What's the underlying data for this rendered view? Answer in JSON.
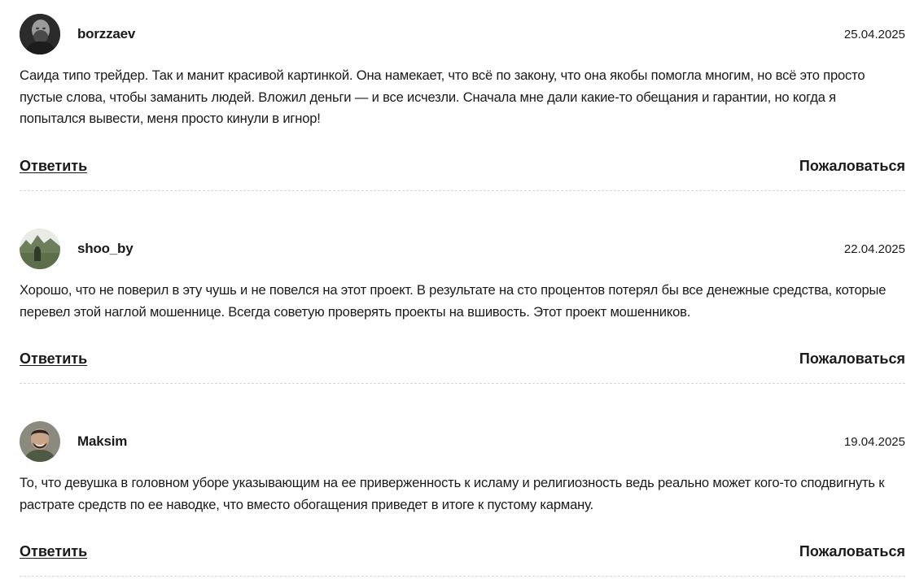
{
  "comments": [
    {
      "author": "borzzaev",
      "date": "25.04.2025",
      "text": "Саида типо трейдер. Так и манит красивой картинкой. Она намекает, что всё по закону, что она якобы помогла многим, но всё это просто пустые слова, чтобы заманить людей. Вложил деньги — и все исчезли. Сначала мне дали какие-то обещания и гарантии, но когда я попытался вывести, меня просто кинули в игнор!",
      "reply_label": "Ответить",
      "report_label": "Пожаловаться",
      "avatar_icon": "user-photo-icon"
    },
    {
      "author": "shoo_by",
      "date": "22.04.2025",
      "text": "Хорошо, что не поверил в эту чушь и не повелся на этот проект. В результате на сто процентов потерял бы все денежные средства, которые перевел этой наглой мошеннице. Всегда советую проверять проекты на вшивость. Этот проект мошенников.",
      "reply_label": "Ответить",
      "report_label": "Пожаловаться",
      "avatar_icon": "user-photo-icon"
    },
    {
      "author": "Maksim",
      "date": "19.04.2025",
      "text": "То, что девушка в головном уборе указывающим на ее приверженность к исламу и религиозность ведь реально может кого-то сподвигнуть к растрате средств по ее наводке, что вместо обогащения приведет в итоге к пустому карману.",
      "reply_label": "Ответить",
      "report_label": "Пожаловаться",
      "avatar_icon": "user-photo-icon"
    }
  ]
}
